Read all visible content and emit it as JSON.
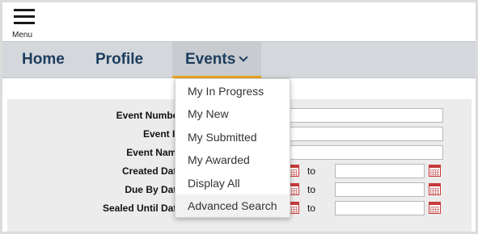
{
  "topbar": {
    "menu_label": "Menu"
  },
  "nav": {
    "home": "Home",
    "profile": "Profile",
    "events": "Events"
  },
  "events_menu": {
    "items": [
      "My In Progress",
      "My New",
      "My Submitted",
      "My Awarded",
      "Display All",
      "Advanced Search"
    ],
    "highlighted": "Advanced Search"
  },
  "form": {
    "event_number_label": "Event Number",
    "event_id_label": "Event ID",
    "event_name_label": "Event Name",
    "created_date_label": "Created Date",
    "due_by_date_label": "Due By Date",
    "sealed_until_date_label": "Sealed Until Date",
    "to_label": "to"
  },
  "colors": {
    "nav_background": "#d4d7db",
    "nav_text": "#1c3d5e",
    "active_underline": "#e9a521",
    "calendar_icon": "#c63b3b"
  }
}
